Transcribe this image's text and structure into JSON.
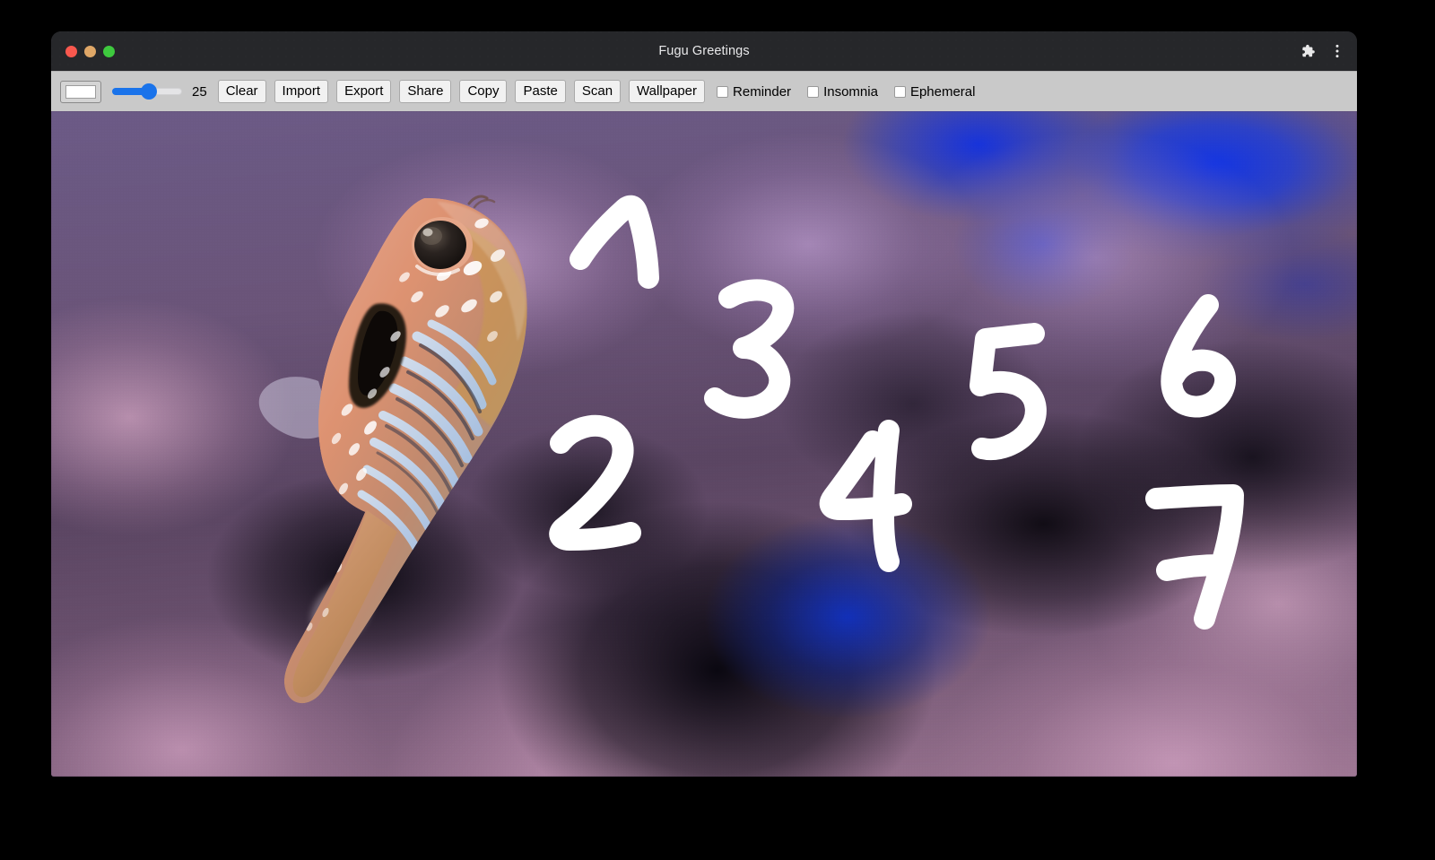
{
  "window": {
    "title": "Fugu Greetings",
    "traffic_lights": [
      {
        "name": "close",
        "color": "#f9584e"
      },
      {
        "name": "minimize",
        "color": "#dfa767"
      },
      {
        "name": "maximize",
        "color": "#3ec93e"
      }
    ],
    "titlebar_icons": [
      {
        "name": "extensions-puzzle-icon"
      },
      {
        "name": "browser-menu-icon"
      }
    ]
  },
  "toolbar": {
    "color_picker": {
      "name": "color-picker",
      "value": "#ffffff"
    },
    "stroke_slider": {
      "name": "stroke-width-slider",
      "value": 25,
      "min": 0,
      "max": 50,
      "fill_percent": 50
    },
    "stroke_value_label": "25",
    "buttons": [
      {
        "label": "Clear"
      },
      {
        "label": "Import"
      },
      {
        "label": "Export"
      },
      {
        "label": "Share"
      },
      {
        "label": "Copy"
      },
      {
        "label": "Paste"
      },
      {
        "label": "Scan"
      },
      {
        "label": "Wallpaper"
      }
    ],
    "checkboxes": [
      {
        "label": "Reminder",
        "checked": false
      },
      {
        "label": "Insomnia",
        "checked": false
      },
      {
        "label": "Ephemeral",
        "checked": false
      }
    ]
  },
  "canvas": {
    "background_photo": "blurred underwater coral reef with pufferfish (fugu)",
    "photo_subject": "fugu-pufferfish",
    "accent_colors": {
      "deep_blue": "#1233e0",
      "mauve": "#b98ead",
      "shadow": "#0a0812",
      "stroke_white": "#ffffff"
    },
    "drawn_strokes": {
      "color": "#ffffff",
      "stroke_width": 25,
      "numerals": [
        "1",
        "2",
        "3",
        "4",
        "5",
        "6",
        "7"
      ]
    }
  }
}
